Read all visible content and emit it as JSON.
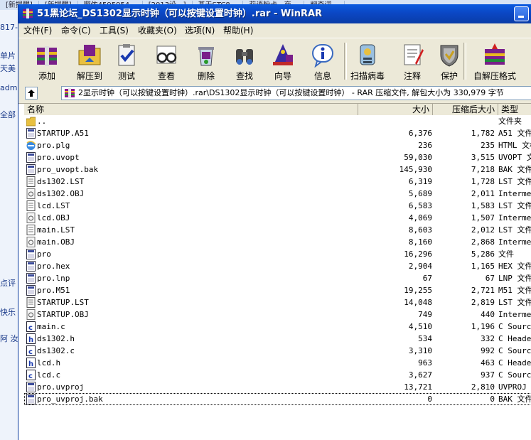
{
  "background": {
    "tabs": [
      "[新提醒]",
      "[新提醒]",
      "啊依4595954...",
      "[2013设...]",
      "基于STC8...",
      "莉语粉卡...商...",
      "翻查词..."
    ],
    "left_items": [
      "817-",
      "单片",
      "天美",
      "adm",
      "全部",
      "点评",
      "快乐",
      "阿 汝"
    ]
  },
  "window": {
    "title": "51黑论坛_DS1302显示时钟（可以按键设置时钟）.rar - WinRAR"
  },
  "menu": [
    "文件(F)",
    "命令(C)",
    "工具(S)",
    "收藏夹(O)",
    "选项(N)",
    "帮助(H)"
  ],
  "toolbar": [
    {
      "label": "添加",
      "icon": "add-books-icon"
    },
    {
      "label": "解压到",
      "icon": "extract-folder-icon"
    },
    {
      "label": "测试",
      "icon": "test-clipboard-icon"
    },
    {
      "label": "查看",
      "icon": "view-glasses-icon"
    },
    {
      "label": "删除",
      "icon": "delete-recycle-icon"
    },
    {
      "label": "查找",
      "icon": "find-binoculars-icon"
    },
    {
      "label": "向导",
      "icon": "wizard-icon"
    },
    {
      "label": "信息",
      "icon": "info-icon"
    },
    {
      "label": "扫描病毒",
      "icon": "scan-virus-icon"
    },
    {
      "label": "注释",
      "icon": "comment-icon"
    },
    {
      "label": "保护",
      "icon": "protect-shield-icon"
    },
    {
      "label": "自解压格式",
      "icon": "sfx-icon"
    }
  ],
  "address": {
    "path": "2显示时钟（可以按键设置时钟）.rar\\DS1302显示时钟（可以按键设置时钟） - RAR 压缩文件, 解包大小为 330,979 字节"
  },
  "columns": {
    "name": "名称",
    "size": "大小",
    "packed": "压缩后大小",
    "type": "类型"
  },
  "files": [
    {
      "name": "..",
      "size": "",
      "packed": "",
      "type": "文件夹",
      "icon": "folder-icon"
    },
    {
      "name": "STARTUP.A51",
      "size": "6,376",
      "packed": "1,782",
      "type": "A51 文件",
      "icon": "file-icon"
    },
    {
      "name": "pro.plg",
      "size": "236",
      "packed": "235",
      "type": "HTML 文档",
      "icon": "ie-icon"
    },
    {
      "name": "pro.uvopt",
      "size": "59,030",
      "packed": "3,515",
      "type": "UVOPT 文件",
      "icon": "file-icon"
    },
    {
      "name": "pro_uvopt.bak",
      "size": "145,930",
      "packed": "7,218",
      "type": "BAK 文件",
      "icon": "file-icon"
    },
    {
      "name": "ds1302.LST",
      "size": "6,319",
      "packed": "1,728",
      "type": "LST 文件",
      "icon": "text-icon"
    },
    {
      "name": "ds1302.OBJ",
      "size": "5,689",
      "packed": "2,011",
      "type": "Intermediate",
      "icon": "obj-icon"
    },
    {
      "name": "lcd.LST",
      "size": "6,583",
      "packed": "1,583",
      "type": "LST 文件",
      "icon": "text-icon"
    },
    {
      "name": "lcd.OBJ",
      "size": "4,069",
      "packed": "1,507",
      "type": "Intermediate",
      "icon": "obj-icon"
    },
    {
      "name": "main.LST",
      "size": "8,603",
      "packed": "2,012",
      "type": "LST 文件",
      "icon": "text-icon"
    },
    {
      "name": "main.OBJ",
      "size": "8,160",
      "packed": "2,868",
      "type": "Intermediate",
      "icon": "obj-icon"
    },
    {
      "name": "pro",
      "size": "16,296",
      "packed": "5,286",
      "type": "文件",
      "icon": "file-icon"
    },
    {
      "name": "pro.hex",
      "size": "2,904",
      "packed": "1,165",
      "type": "HEX 文件",
      "icon": "file-icon"
    },
    {
      "name": "pro.lnp",
      "size": "67",
      "packed": "67",
      "type": "LNP 文件",
      "icon": "file-icon"
    },
    {
      "name": "pro.M51",
      "size": "19,255",
      "packed": "2,721",
      "type": "M51 文件",
      "icon": "file-icon"
    },
    {
      "name": "STARTUP.LST",
      "size": "14,048",
      "packed": "2,819",
      "type": "LST 文件",
      "icon": "text-icon"
    },
    {
      "name": "STARTUP.OBJ",
      "size": "749",
      "packed": "440",
      "type": "Intermediate",
      "icon": "obj-icon"
    },
    {
      "name": "main.c",
      "size": "4,510",
      "packed": "1,196",
      "type": "C Source file",
      "icon": "c-source-icon"
    },
    {
      "name": "ds1302.h",
      "size": "534",
      "packed": "332",
      "type": "C Header file",
      "icon": "c-header-icon"
    },
    {
      "name": "ds1302.c",
      "size": "3,310",
      "packed": "992",
      "type": "C Source file",
      "icon": "c-source-icon"
    },
    {
      "name": "lcd.h",
      "size": "963",
      "packed": "463",
      "type": "C Header file",
      "icon": "c-header-icon"
    },
    {
      "name": "lcd.c",
      "size": "3,627",
      "packed": "937",
      "type": "C Source file",
      "icon": "c-source-icon"
    },
    {
      "name": "pro.uvproj",
      "size": "13,721",
      "packed": "2,810",
      "type": "UVPROJ 文件",
      "icon": "file-icon"
    },
    {
      "name": "pro_uvproj.bak",
      "size": "0",
      "packed": "0",
      "type": "BAK 文件",
      "icon": "file-icon"
    }
  ]
}
